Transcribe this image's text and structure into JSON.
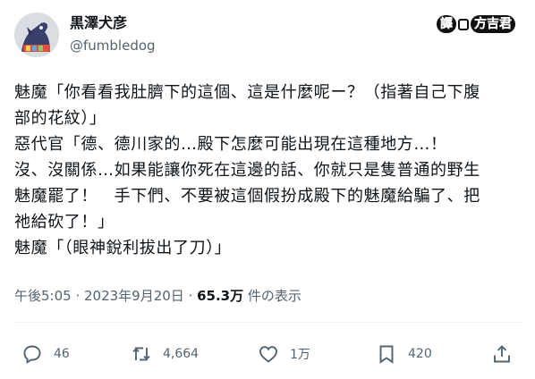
{
  "author": {
    "display_name": "黒澤犬彦",
    "handle": "@fumbledog"
  },
  "translate_badge": {
    "left": "譯",
    "right": "方吉君"
  },
  "tweet": {
    "lines": [
      "魅魔「你看看我肚臍下的這個、這是什麼呢ー？（指著自己下腹",
      "部的花紋）」",
      "惡代官「德、德川家的…殿下怎麼可能出現在這種地方…！",
      "沒、沒關係…如果能讓你死在這邊的話、你就只是隻普通的野生",
      "魅魔罷了！　手下們、不要被這個假扮成殿下的魅魔給騙了、把",
      "祂給砍了！」",
      "魅魔「（眼神銳利拔出了刀）」"
    ]
  },
  "meta": {
    "timestamp": "午後5:05 · 2023年9月20日",
    "separator": " · ",
    "views_count": "65.3万",
    "views_label": " 件の表示"
  },
  "actions": {
    "reply_count": "46",
    "repost_count": "4,664",
    "like_count": "1万",
    "bookmark_count": "420"
  },
  "colors": {
    "text": "#0f1419",
    "secondary": "#536471",
    "divider": "#eff3f4"
  }
}
